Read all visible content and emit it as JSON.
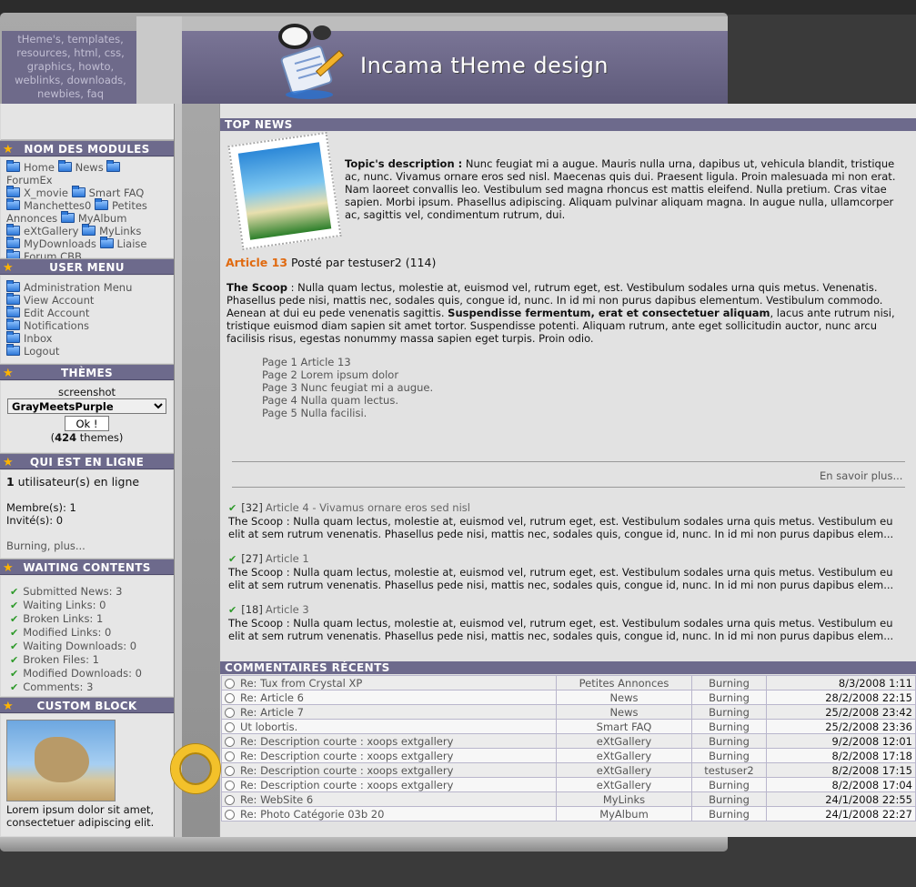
{
  "header": {
    "site_title": "Incama tHeme design",
    "slogan": "tHeme's, templates, resources, html, css, graphics, howto, weblinks, downloads, newbies, faq"
  },
  "blocks": {
    "modules": {
      "title": "NOM DES MODULES",
      "items": [
        "Home",
        "News",
        "ForumEx",
        "X_movie",
        "Smart FAQ",
        "Manchettes0",
        "Petites Annonces",
        "MyAlbum",
        "eXtGallery",
        "MyLinks",
        "MyDownloads",
        "Liaise",
        "Forum CBB"
      ]
    },
    "user_menu": {
      "title": "USER MENU",
      "items": [
        "Administration Menu",
        "View Account",
        "Edit Account",
        "Notifications",
        "Inbox",
        "Logout"
      ]
    },
    "themes": {
      "title": "THÈMES",
      "label": "screenshot",
      "selected": "GrayMeetsPurple",
      "ok_label": "Ok !",
      "count_prefix": "(",
      "count": "424",
      "count_suffix": " themes)"
    },
    "online": {
      "title": "QUI EST EN LIGNE",
      "users_count": "1",
      "users_label": " utilisateur(s) en ligne",
      "members": "Membre(s): 1",
      "guests": "Invité(s): 0",
      "who": "Burning, plus..."
    },
    "waiting": {
      "title": "WAITING CONTENTS",
      "items": [
        "Submitted News: 3",
        "Waiting Links: 0",
        "Broken Links: 1",
        "Modified Links: 0",
        "Waiting Downloads: 0",
        "Broken Files: 1",
        "Modified Downloads: 0",
        "Comments: 3"
      ]
    },
    "custom": {
      "title": "CUSTOM BLOCK",
      "text": "Lorem ipsum dolor sit amet, consectetuer adipiscing elit."
    }
  },
  "main": {
    "top_news_title": "TOP NEWS",
    "topic_label": "Topic's description :",
    "topic_text": " Nunc feugiat mi a augue. Mauris nulla urna, dapibus ut, vehicula blandit, tristique ac, nunc. Vivamus ornare eros sed nisl. Maecenas quis dui. Praesent ligula. Proin malesuada mi non erat. Nam laoreet convallis leo. Vestibulum sed magna rhoncus est mattis eleifend. Nulla pretium. Cras vitae sapien. Morbi ipsum. Phasellus adipiscing. Aliquam pulvinar aliquam magna. In augue nulla, ullamcorper ac, sagittis vel, condimentum rutrum, dui.",
    "article_label": "Article 13",
    "article_posted": " Posté par testuser2 (114)",
    "scoop_label": "The Scoop",
    "scoop_text1": " : Nulla quam lectus, molestie at, euismod vel, rutrum eget, est. Vestibulum sodales urna quis metus. Venenatis. Phasellus pede nisi, mattis nec, sodales quis, congue id, nunc. In id mi non purus dapibus elementum. Vestibulum commodo. Aenean at dui eu pede venenatis sagittis. ",
    "scoop_bold": "Suspendisse fermentum, erat et consectetuer aliquam",
    "scoop_text2": ", lacus ante rutrum nisi, tristique euismod diam sapien sit amet tortor. Suspendisse potenti. Aliquam rutrum, ante eget sollicitudin auctor, nunc arcu facilisis risus, egestas nonummy massa sapien eget turpis. Proin odio.",
    "pages": [
      "Page 1 Article 13",
      "Page 2 Lorem ipsum dolor",
      "Page 3 Nunc feugiat mi a augue.",
      "Page 4 Nulla quam lectus.",
      "Page 5 Nulla facilisi."
    ],
    "read_more": "En savoir plus...",
    "news": [
      {
        "idx": "[32]",
        "title": "Article 4 - Vivamus ornare eros sed nisl",
        "text": "The Scoop : Nulla quam lectus, molestie at, euismod vel, rutrum eget, est. Vestibulum sodales urna quis metus. Vestibulum eu elit at sem rutrum venenatis. Phasellus pede nisi, mattis nec, sodales quis, congue id, nunc. In id mi non purus dapibus elem..."
      },
      {
        "idx": "[27]",
        "title": "Article 1",
        "text": "The Scoop : Nulla quam lectus, molestie at, euismod vel, rutrum eget, est. Vestibulum sodales urna quis metus. Vestibulum eu elit at sem rutrum venenatis. Phasellus pede nisi, mattis nec, sodales quis, congue id, nunc. In id mi non purus dapibus elem..."
      },
      {
        "idx": "[18]",
        "title": "Article 3",
        "text": "The Scoop : Nulla quam lectus, molestie at, euismod vel, rutrum eget, est. Vestibulum sodales urna quis metus. Vestibulum eu elit at sem rutrum venenatis. Phasellus pede nisi, mattis nec, sodales quis, congue id, nunc. In id mi non purus dapibus elem..."
      }
    ],
    "comments_title": "COMMENTAIRES RÉCENTS",
    "comments": [
      {
        "title": "Re: Tux from Crystal XP",
        "module": "Petites Annonces",
        "user": "Burning",
        "date": "8/3/2008 1:11"
      },
      {
        "title": "Re: Article 6",
        "module": "News",
        "user": "Burning",
        "date": "28/2/2008 22:15"
      },
      {
        "title": "Re: Article 7",
        "module": "News",
        "user": "Burning",
        "date": "25/2/2008 23:42"
      },
      {
        "title": "Ut lobortis.",
        "module": "Smart FAQ",
        "user": "Burning",
        "date": "25/2/2008 23:36"
      },
      {
        "title": "Re: Description courte : xoops extgallery",
        "module": "eXtGallery",
        "user": "Burning",
        "date": "9/2/2008 12:01"
      },
      {
        "title": "Re: Description courte : xoops extgallery",
        "module": "eXtGallery",
        "user": "Burning",
        "date": "8/2/2008 17:18"
      },
      {
        "title": "Re: Description courte : xoops extgallery",
        "module": "eXtGallery",
        "user": "testuser2",
        "date": "8/2/2008 17:15"
      },
      {
        "title": "Re: Description courte : xoops extgallery",
        "module": "eXtGallery",
        "user": "Burning",
        "date": "8/2/2008 17:04"
      },
      {
        "title": "Re: WebSite 6",
        "module": "MyLinks",
        "user": "Burning",
        "date": "24/1/2008 22:55"
      },
      {
        "title": "Re: Photo Catégorie 03b 20",
        "module": "MyAlbum",
        "user": "Burning",
        "date": "24/1/2008 22:27"
      }
    ]
  },
  "colors": {
    "title_bar": "#6d6a8c",
    "article_accent": "#e06a10",
    "check": "#2e9a2a"
  }
}
